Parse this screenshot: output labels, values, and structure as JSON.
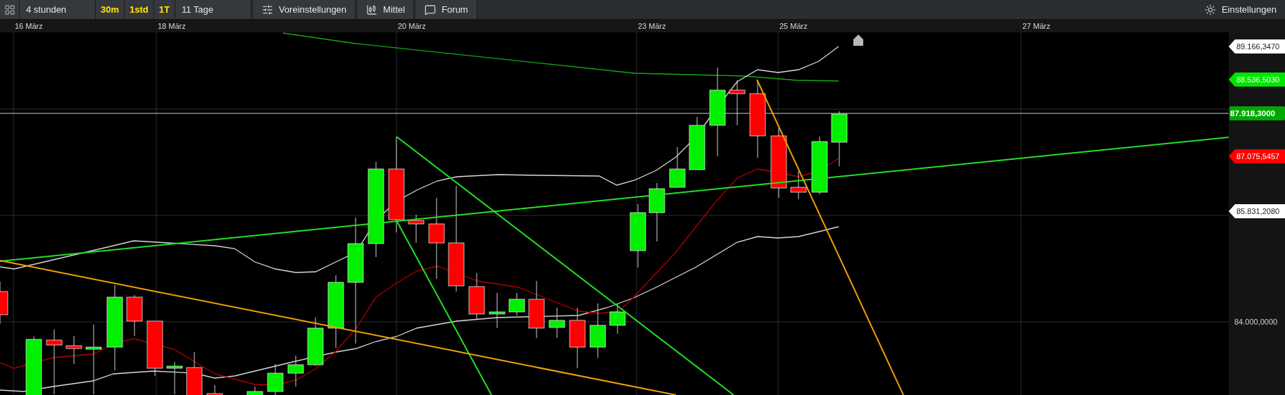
{
  "toolbar": {
    "items": [
      {
        "kind": "range",
        "label": "4 stunden"
      },
      {
        "kind": "interval",
        "label": "30m"
      },
      {
        "kind": "interval",
        "label": "1std"
      },
      {
        "kind": "interval",
        "label": "1T"
      },
      {
        "kind": "range",
        "label": "11 Tage"
      },
      {
        "kind": "presets",
        "label": "Voreinstellungen"
      },
      {
        "kind": "indicators",
        "label": "Mittel"
      },
      {
        "kind": "forum",
        "label": "Forum"
      }
    ],
    "settings": {
      "label": "Einstellungen"
    }
  },
  "date_axis": [
    "16 März",
    "18 März",
    "20 März",
    "23 März",
    "25 März",
    "27 März"
  ],
  "price_axis": [
    {
      "kind": "tag",
      "color": "#ffffff",
      "text": "89.166,3470"
    },
    {
      "kind": "tag",
      "color": "#00e600",
      "text": "88.536,5030"
    },
    {
      "kind": "current",
      "color": "#00a800",
      "text": "87.918,3000"
    },
    {
      "kind": "tag",
      "color": "#ff0000",
      "text": "87.075,5457"
    },
    {
      "kind": "tag",
      "color": "#ffffff",
      "text": "85.831,2080"
    },
    {
      "kind": "tick",
      "text": "84.000,0000"
    }
  ]
}
